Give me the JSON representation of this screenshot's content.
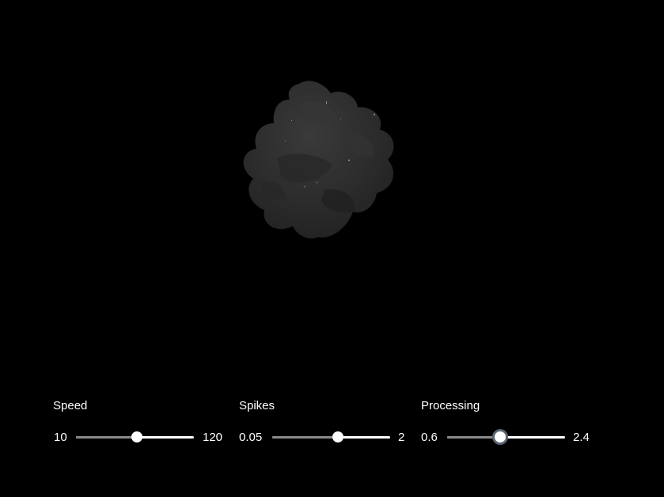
{
  "scene": {
    "background": "#000000",
    "object": "blob"
  },
  "controls": [
    {
      "label": "Speed",
      "min_label": "10",
      "max_label": "120",
      "value_fraction": 0.52,
      "focused": false
    },
    {
      "label": "Spikes",
      "min_label": "0.05",
      "max_label": "2",
      "value_fraction": 0.56,
      "focused": false
    },
    {
      "label": "Processing",
      "min_label": "0.6",
      "max_label": "2.4",
      "value_fraction": 0.45,
      "focused": true
    }
  ],
  "colors": {
    "track_active": "#ffffff",
    "track_inactive": "#8a8a8a",
    "thumb": "#ffffff",
    "thumb_focus_ring": "#5b6470",
    "blob": "#2d2d2d"
  }
}
